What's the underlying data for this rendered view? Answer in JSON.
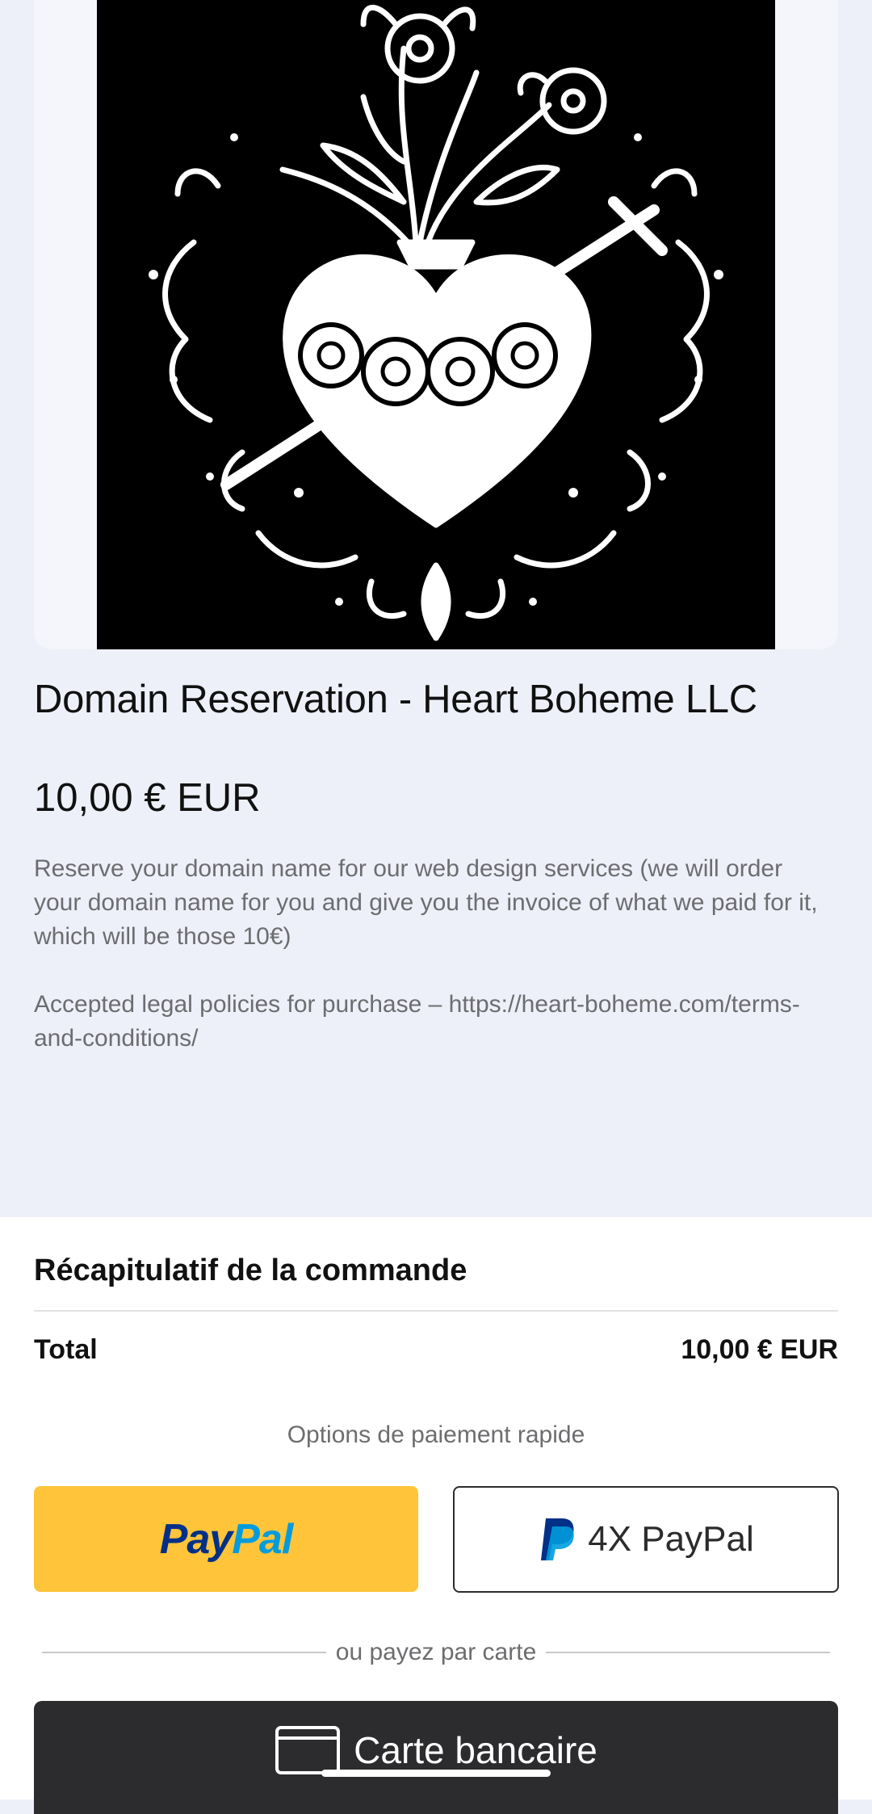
{
  "product": {
    "title": "Domain Reservation - Heart Boheme LLC",
    "price": "10,00 € EUR",
    "description": "Reserve your domain name for our web design services (we will order your domain name for you and give you the invoice of what we paid for it, which will be those 10€)",
    "policies": "Accepted legal policies for purchase – https://heart-boheme.com/terms-and-conditions/"
  },
  "summary": {
    "title": "Récapitulatif de la commande",
    "total_label": "Total",
    "total_value": "10,00 € EUR"
  },
  "payment": {
    "express_label": "Options de paiement rapide",
    "paypal_part1": "Pay",
    "paypal_part2": "Pal",
    "paypal4x_label": "4X PayPal",
    "or_card": "ou payez par carte",
    "card_button_label": "Carte bancaire"
  },
  "colors": {
    "page_bg": "#eef0f9",
    "paypal_yellow": "#ffc439",
    "paypal_dark_blue": "#003087",
    "paypal_light_blue": "#009cde",
    "card_button_bg": "#2c2c2e"
  },
  "icons": {
    "paypal_logo": "paypal-p-icon",
    "card": "credit-card-icon"
  }
}
